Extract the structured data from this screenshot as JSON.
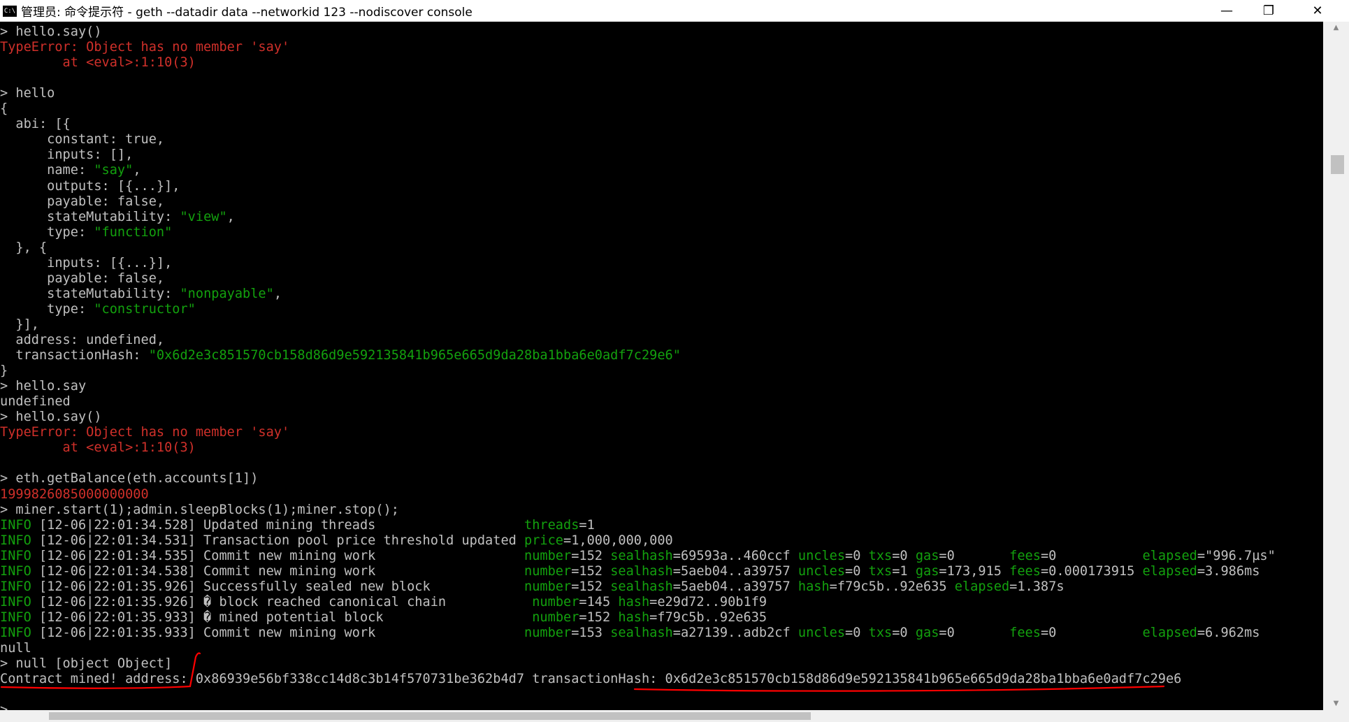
{
  "window": {
    "icon_text": "C:\\",
    "title": "管理员: 命令提示符 - geth  --datadir data --networkid 123 --nodiscover console",
    "minimize": "—",
    "maximize": "❐",
    "close": "✕"
  },
  "console": {
    "lines": [
      [
        [
          "w",
          "> hello.say()"
        ]
      ],
      [
        [
          "r",
          "TypeError: Object has no member 'say'"
        ]
      ],
      [
        [
          "r",
          "        at <eval>:1:10(3)"
        ]
      ],
      [],
      [
        [
          "w",
          "> hello"
        ]
      ],
      [
        [
          "w",
          "{"
        ]
      ],
      [
        [
          "w",
          "  abi: [{"
        ]
      ],
      [
        [
          "w",
          "      constant: true,"
        ]
      ],
      [
        [
          "w",
          "      inputs: [],"
        ]
      ],
      [
        [
          "w",
          "      name: "
        ],
        [
          "g",
          "\"say\""
        ],
        [
          "w",
          ","
        ]
      ],
      [
        [
          "w",
          "      outputs: [{...}],"
        ]
      ],
      [
        [
          "w",
          "      payable: false,"
        ]
      ],
      [
        [
          "w",
          "      stateMutability: "
        ],
        [
          "g",
          "\"view\""
        ],
        [
          "w",
          ","
        ]
      ],
      [
        [
          "w",
          "      type: "
        ],
        [
          "g",
          "\"function\""
        ]
      ],
      [
        [
          "w",
          "  }, {"
        ]
      ],
      [
        [
          "w",
          "      inputs: [{...}],"
        ]
      ],
      [
        [
          "w",
          "      payable: false,"
        ]
      ],
      [
        [
          "w",
          "      stateMutability: "
        ],
        [
          "g",
          "\"nonpayable\""
        ],
        [
          "w",
          ","
        ]
      ],
      [
        [
          "w",
          "      type: "
        ],
        [
          "g",
          "\"constructor\""
        ]
      ],
      [
        [
          "w",
          "  }],"
        ]
      ],
      [
        [
          "w",
          "  address: undefined,"
        ]
      ],
      [
        [
          "w",
          "  transactionHash: "
        ],
        [
          "g",
          "\"0x6d2e3c851570cb158d86d9e592135841b965e665d9da28ba1bba6e0adf7c29e6\""
        ]
      ],
      [
        [
          "w",
          "}"
        ]
      ],
      [
        [
          "w",
          "> hello.say"
        ]
      ],
      [
        [
          "w",
          "undefined"
        ]
      ],
      [
        [
          "w",
          "> hello.say()"
        ]
      ],
      [
        [
          "r",
          "TypeError: Object has no member 'say'"
        ]
      ],
      [
        [
          "r",
          "        at <eval>:1:10(3)"
        ]
      ],
      [],
      [
        [
          "w",
          "> eth.getBalance(eth.accounts[1])"
        ]
      ],
      [
        [
          "r",
          "1999826085000000000"
        ]
      ],
      [
        [
          "w",
          "> miner.start(1);admin.sleepBlocks(1);miner.stop();"
        ]
      ],
      [
        [
          "g",
          "INFO"
        ],
        [
          "w",
          " [12-06|22:01:34.528] Updated mining threads                   "
        ],
        [
          "g",
          "threads"
        ],
        [
          "w",
          "=1"
        ]
      ],
      [
        [
          "g",
          "INFO"
        ],
        [
          "w",
          " [12-06|22:01:34.531] Transaction pool price threshold updated "
        ],
        [
          "g",
          "price"
        ],
        [
          "w",
          "=1,000,000,000"
        ]
      ],
      [
        [
          "g",
          "INFO"
        ],
        [
          "w",
          " [12-06|22:01:34.535] Commit new mining work                   "
        ],
        [
          "g",
          "number"
        ],
        [
          "w",
          "=152 "
        ],
        [
          "g",
          "sealhash"
        ],
        [
          "w",
          "=69593a..460ccf "
        ],
        [
          "g",
          "uncles"
        ],
        [
          "w",
          "=0 "
        ],
        [
          "g",
          "txs"
        ],
        [
          "w",
          "=0 "
        ],
        [
          "g",
          "gas"
        ],
        [
          "w",
          "=0       "
        ],
        [
          "g",
          "fees"
        ],
        [
          "w",
          "=0           "
        ],
        [
          "g",
          "elapsed"
        ],
        [
          "w",
          "=\"996.7µs\""
        ]
      ],
      [
        [
          "g",
          "INFO"
        ],
        [
          "w",
          " [12-06|22:01:34.538] Commit new mining work                   "
        ],
        [
          "g",
          "number"
        ],
        [
          "w",
          "=152 "
        ],
        [
          "g",
          "sealhash"
        ],
        [
          "w",
          "=5aeb04..a39757 "
        ],
        [
          "g",
          "uncles"
        ],
        [
          "w",
          "=0 "
        ],
        [
          "g",
          "txs"
        ],
        [
          "w",
          "=1 "
        ],
        [
          "g",
          "gas"
        ],
        [
          "w",
          "=173,915 "
        ],
        [
          "g",
          "fees"
        ],
        [
          "w",
          "=0.000173915 "
        ],
        [
          "g",
          "elapsed"
        ],
        [
          "w",
          "=3.986ms"
        ]
      ],
      [
        [
          "g",
          "INFO"
        ],
        [
          "w",
          " [12-06|22:01:35.926] Successfully sealed new block            "
        ],
        [
          "g",
          "number"
        ],
        [
          "w",
          "=152 "
        ],
        [
          "g",
          "sealhash"
        ],
        [
          "w",
          "=5aeb04..a39757 "
        ],
        [
          "g",
          "hash"
        ],
        [
          "w",
          "=f79c5b..92e635 "
        ],
        [
          "g",
          "elapsed"
        ],
        [
          "w",
          "=1.387s"
        ]
      ],
      [
        [
          "g",
          "INFO"
        ],
        [
          "w",
          " [12-06|22:01:35.926] � block reached canonical chain           "
        ],
        [
          "g",
          "number"
        ],
        [
          "w",
          "=145 "
        ],
        [
          "g",
          "hash"
        ],
        [
          "w",
          "=e29d72..90b1f9"
        ]
      ],
      [
        [
          "g",
          "INFO"
        ],
        [
          "w",
          " [12-06|22:01:35.933] � mined potential block                   "
        ],
        [
          "g",
          "number"
        ],
        [
          "w",
          "=152 "
        ],
        [
          "g",
          "hash"
        ],
        [
          "w",
          "=f79c5b..92e635"
        ]
      ],
      [
        [
          "g",
          "INFO"
        ],
        [
          "w",
          " [12-06|22:01:35.933] Commit new mining work                   "
        ],
        [
          "g",
          "number"
        ],
        [
          "w",
          "=153 "
        ],
        [
          "g",
          "sealhash"
        ],
        [
          "w",
          "=a27139..adb2cf "
        ],
        [
          "g",
          "uncles"
        ],
        [
          "w",
          "=0 "
        ],
        [
          "g",
          "txs"
        ],
        [
          "w",
          "=0 "
        ],
        [
          "g",
          "gas"
        ],
        [
          "w",
          "=0       "
        ],
        [
          "g",
          "fees"
        ],
        [
          "w",
          "=0           "
        ],
        [
          "g",
          "elapsed"
        ],
        [
          "w",
          "=6.962ms"
        ]
      ],
      [
        [
          "w",
          "null"
        ]
      ],
      [
        [
          "w",
          "> null [object Object]"
        ]
      ],
      [
        [
          "w",
          "Contract mined! address: 0x86939e56bf338cc14d8c3b14f570731be362b4d7 transactionHash: 0x6d2e3c851570cb158d86d9e592135841b965e665d9da28ba1bba6e0adf7c29e6"
        ]
      ],
      [],
      [
        [
          "w",
          "> "
        ]
      ]
    ]
  },
  "colors": {
    "background": "#000000",
    "text": "#c0c0c0",
    "error": "#d0302a",
    "string": "#13a10e",
    "annotation": "#ff0000"
  }
}
